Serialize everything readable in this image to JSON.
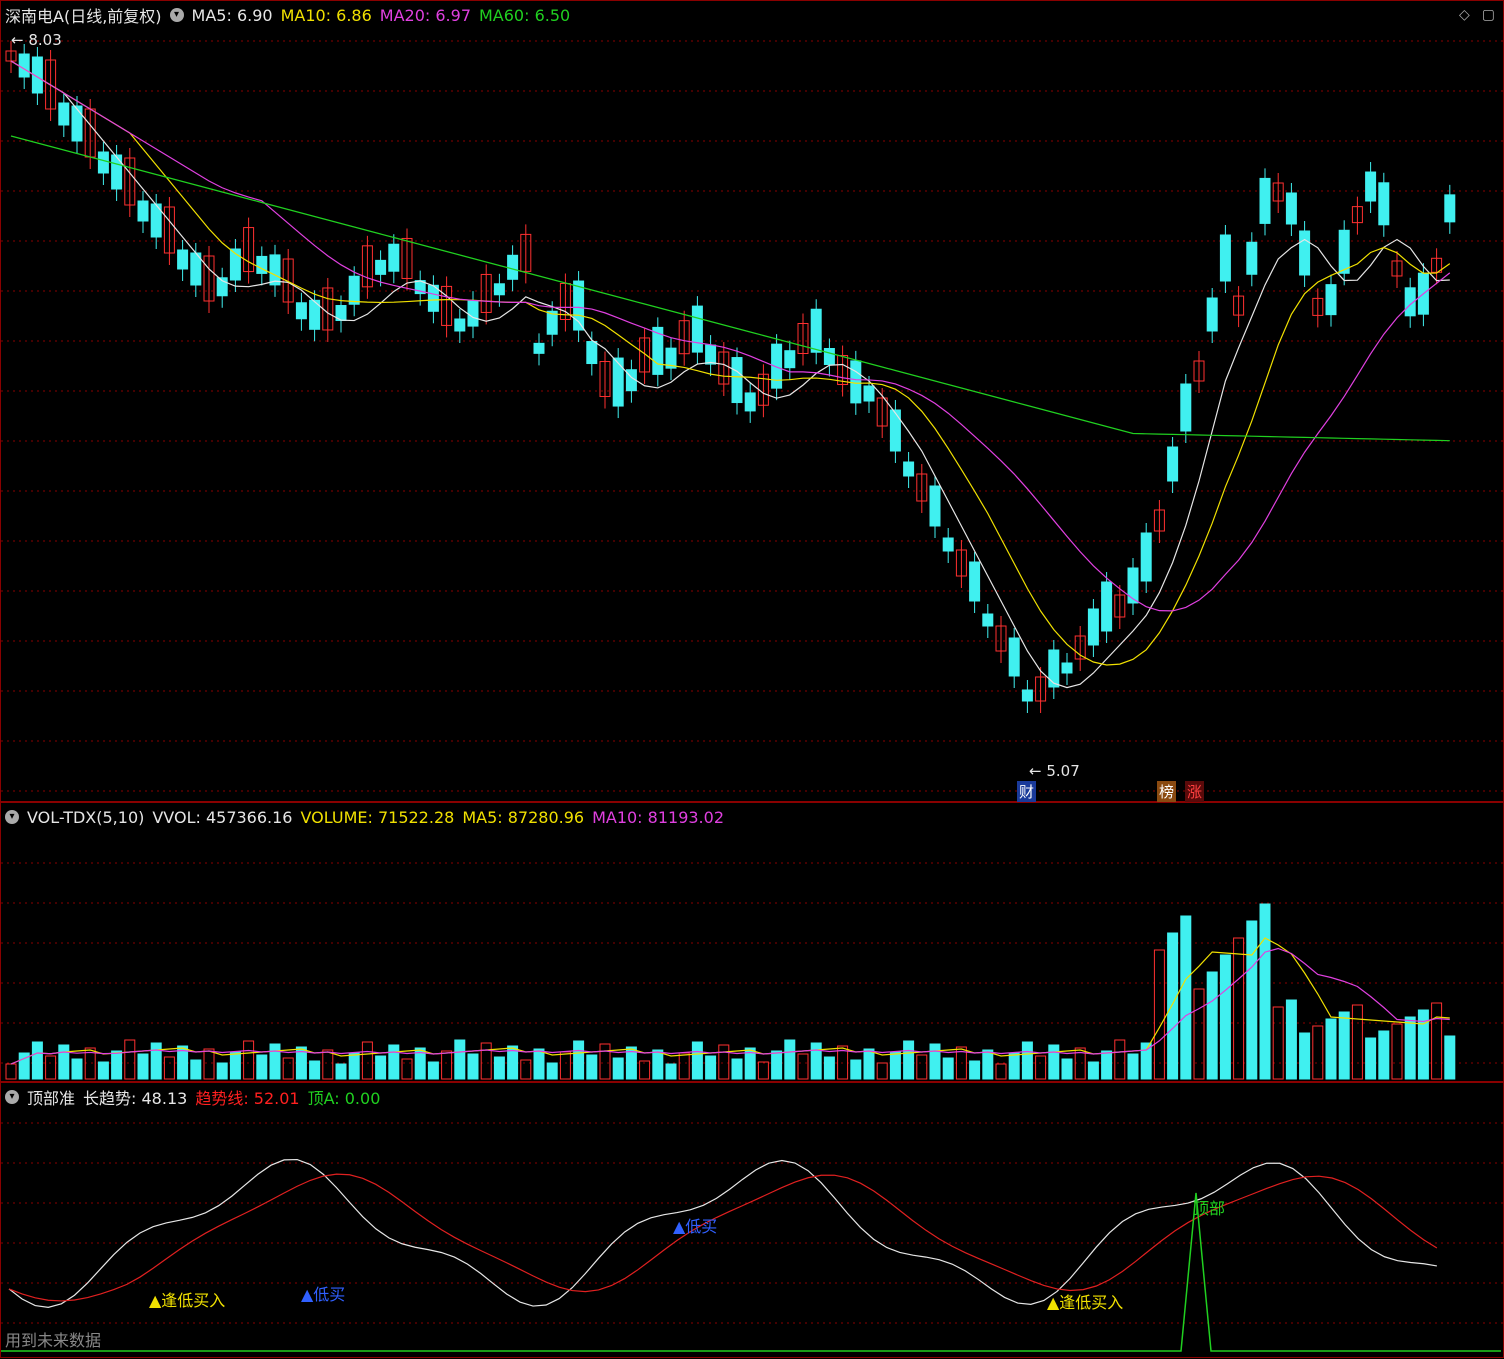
{
  "price_panel": {
    "title": "深南电A(日线,前复权)",
    "ma5": "MA5: 6.90",
    "ma10": "MA10: 6.86",
    "ma20": "MA20: 6.97",
    "ma60": "MA60: 6.50",
    "high_label": "8.03",
    "low_label": "5.07",
    "tag_cai": "财",
    "tag_bang": "榜",
    "tag_zhang": "涨",
    "icons": [
      "diamond-icon",
      "window-icon"
    ]
  },
  "vol_panel": {
    "name": "VOL-TDX(5,10)",
    "vvol": "VVOL: 457366.16",
    "volume": "VOLUME: 71522.28",
    "ma5": "MA5: 87280.96",
    "ma10": "MA10: 81193.02"
  },
  "ind_panel": {
    "name": "顶部准",
    "long_trend": "长趋势: 48.13",
    "trend_line": "趋势线: 52.01",
    "top_a": "顶A: 0.00",
    "signals": {
      "buy_low_1": "▲逢低买入",
      "buy_low_2": "▲逢低买入",
      "low_buy_1": "▲低买",
      "low_buy_2": "▲低买",
      "top": "顶部"
    },
    "footer_note": "用到未来数据"
  },
  "colors": {
    "up": "#ff3030",
    "down": "#40f0f0",
    "ma5": "#e6e6e6",
    "ma10": "#f0e000",
    "ma20": "#e040e0",
    "ma60": "#20d020",
    "grid": "#8a0000"
  }
}
